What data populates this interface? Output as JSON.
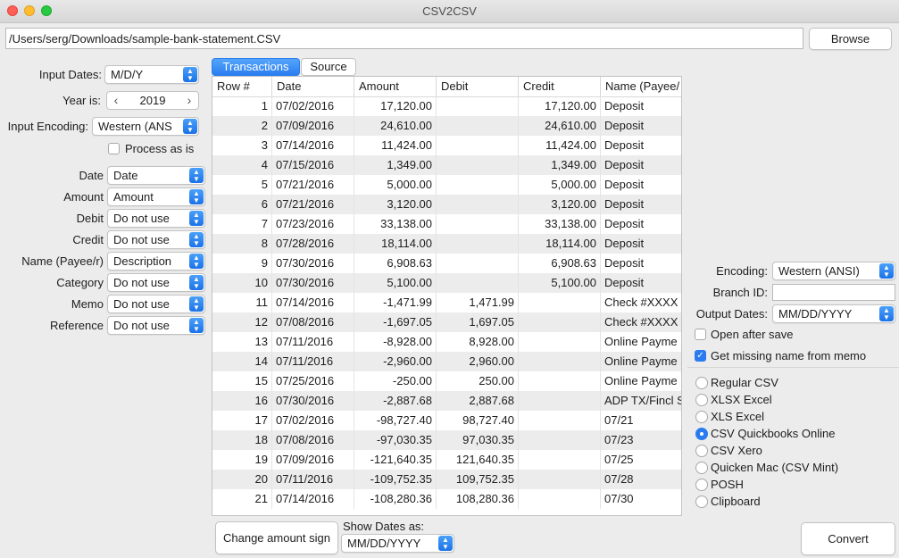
{
  "window": {
    "title": "CSV2CSV"
  },
  "file": {
    "path": "/Users/serg/Downloads/sample-bank-statement.CSV",
    "browse_label": "Browse"
  },
  "left": {
    "input_dates": {
      "label": "Input Dates:",
      "value": "M/D/Y"
    },
    "year": {
      "label": "Year is:",
      "value": "2019"
    },
    "input_encoding": {
      "label": "Input Encoding:",
      "value": "Western (ANS"
    },
    "process_as_is": {
      "label": "Process as is",
      "checked": false
    },
    "mappings": [
      {
        "label": "Date",
        "value": "Date"
      },
      {
        "label": "Amount",
        "value": "Amount"
      },
      {
        "label": "Debit",
        "value": "Do not use"
      },
      {
        "label": "Credit",
        "value": "Do not use"
      },
      {
        "label": "Name (Payee/r)",
        "value": "Description"
      },
      {
        "label": "Category",
        "value": "Do not use"
      },
      {
        "label": "Memo",
        "value": "Do not use"
      },
      {
        "label": "Reference",
        "value": "Do not use"
      }
    ]
  },
  "tabs": [
    {
      "label": "Transactions",
      "active": true
    },
    {
      "label": "Source",
      "active": false
    }
  ],
  "table": {
    "columns": [
      "Row #",
      "Date",
      "Amount",
      "Debit",
      "Credit",
      "Name (Payee/"
    ],
    "rows": [
      [
        "1",
        "07/02/2016",
        "17,120.00",
        "",
        "17,120.00",
        "Deposit"
      ],
      [
        "2",
        "07/09/2016",
        "24,610.00",
        "",
        "24,610.00",
        "Deposit"
      ],
      [
        "3",
        "07/14/2016",
        "11,424.00",
        "",
        "11,424.00",
        "Deposit"
      ],
      [
        "4",
        "07/15/2016",
        "1,349.00",
        "",
        "1,349.00",
        "Deposit"
      ],
      [
        "5",
        "07/21/2016",
        "5,000.00",
        "",
        "5,000.00",
        "Deposit"
      ],
      [
        "6",
        "07/21/2016",
        "3,120.00",
        "",
        "3,120.00",
        "Deposit"
      ],
      [
        "7",
        "07/23/2016",
        "33,138.00",
        "",
        "33,138.00",
        "Deposit"
      ],
      [
        "8",
        "07/28/2016",
        "18,114.00",
        "",
        "18,114.00",
        "Deposit"
      ],
      [
        "9",
        "07/30/2016",
        "6,908.63",
        "",
        "6,908.63",
        "Deposit"
      ],
      [
        "10",
        "07/30/2016",
        "5,100.00",
        "",
        "5,100.00",
        "Deposit"
      ],
      [
        "11",
        "07/14/2016",
        "-1,471.99",
        "1,471.99",
        "",
        "Check #XXXX"
      ],
      [
        "12",
        "07/08/2016",
        "-1,697.05",
        "1,697.05",
        "",
        "Check #XXXX"
      ],
      [
        "13",
        "07/11/2016",
        "-8,928.00",
        "8,928.00",
        "",
        "Online Payme"
      ],
      [
        "14",
        "07/11/2016",
        "-2,960.00",
        "2,960.00",
        "",
        "Online Payme"
      ],
      [
        "15",
        "07/25/2016",
        "-250.00",
        "250.00",
        "",
        "Online Payme"
      ],
      [
        "16",
        "07/30/2016",
        "-2,887.68",
        "2,887.68",
        "",
        "ADP TX/Fincl S"
      ],
      [
        "17",
        "07/02/2016",
        "-98,727.40",
        "98,727.40",
        "",
        "07/21"
      ],
      [
        "18",
        "07/08/2016",
        "-97,030.35",
        "97,030.35",
        "",
        "07/23"
      ],
      [
        "19",
        "07/09/2016",
        "-121,640.35",
        "121,640.35",
        "",
        "07/25"
      ],
      [
        "20",
        "07/11/2016",
        "-109,752.35",
        "109,752.35",
        "",
        "07/28"
      ],
      [
        "21",
        "07/14/2016",
        "-108,280.36",
        "108,280.36",
        "",
        "07/30"
      ]
    ]
  },
  "bottom": {
    "change_sign_label": "Change amount sign",
    "show_dates_label": "Show Dates as:",
    "show_dates_value": "MM/DD/YYYY",
    "convert_label": "Convert"
  },
  "output": {
    "encoding": {
      "label": "Encoding:",
      "value": "Western (ANSI)"
    },
    "branch_id": {
      "label": "Branch ID:",
      "value": ""
    },
    "output_dates": {
      "label": "Output Dates:",
      "value": "MM/DD/YYYY"
    },
    "open_after_save": {
      "label": "Open after save",
      "checked": false
    },
    "get_missing_name": {
      "label": "Get missing name from memo",
      "checked": true
    },
    "formats": [
      {
        "label": "Regular CSV",
        "selected": false
      },
      {
        "label": "XLSX Excel",
        "selected": false
      },
      {
        "label": "XLS Excel",
        "selected": false
      },
      {
        "label": "CSV Quickbooks Online",
        "selected": true
      },
      {
        "label": "CSV Xero",
        "selected": false
      },
      {
        "label": "Quicken Mac (CSV Mint)",
        "selected": false
      },
      {
        "label": "POSH",
        "selected": false
      },
      {
        "label": "Clipboard",
        "selected": false
      }
    ]
  },
  "colors": {
    "accent": "#2a7bf0",
    "row_alt": "#ececec"
  }
}
